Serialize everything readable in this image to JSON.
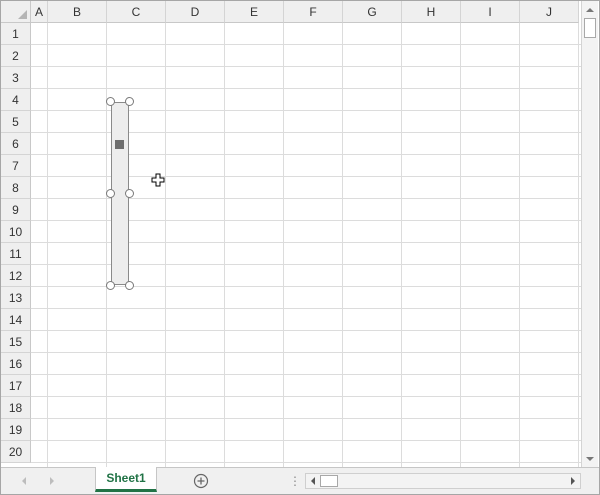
{
  "sheet": {
    "columns": [
      "A",
      "B",
      "C",
      "D",
      "E",
      "F",
      "G",
      "H",
      "I",
      "J"
    ],
    "rows": [
      "1",
      "2",
      "3",
      "4",
      "5",
      "6",
      "7",
      "8",
      "9",
      "10",
      "11",
      "12",
      "13",
      "14",
      "15",
      "16",
      "17",
      "18",
      "19",
      "20"
    ]
  },
  "tabs": {
    "active_sheet": "Sheet1"
  },
  "icons": {
    "corner": "select-all-triangle-icon",
    "add_sheet": "plus-circle-icon",
    "cursor": "move-cursor-icon"
  },
  "colors": {
    "accent": "#217346",
    "header_bg": "#efefef",
    "gridline": "#dcdcdc"
  }
}
